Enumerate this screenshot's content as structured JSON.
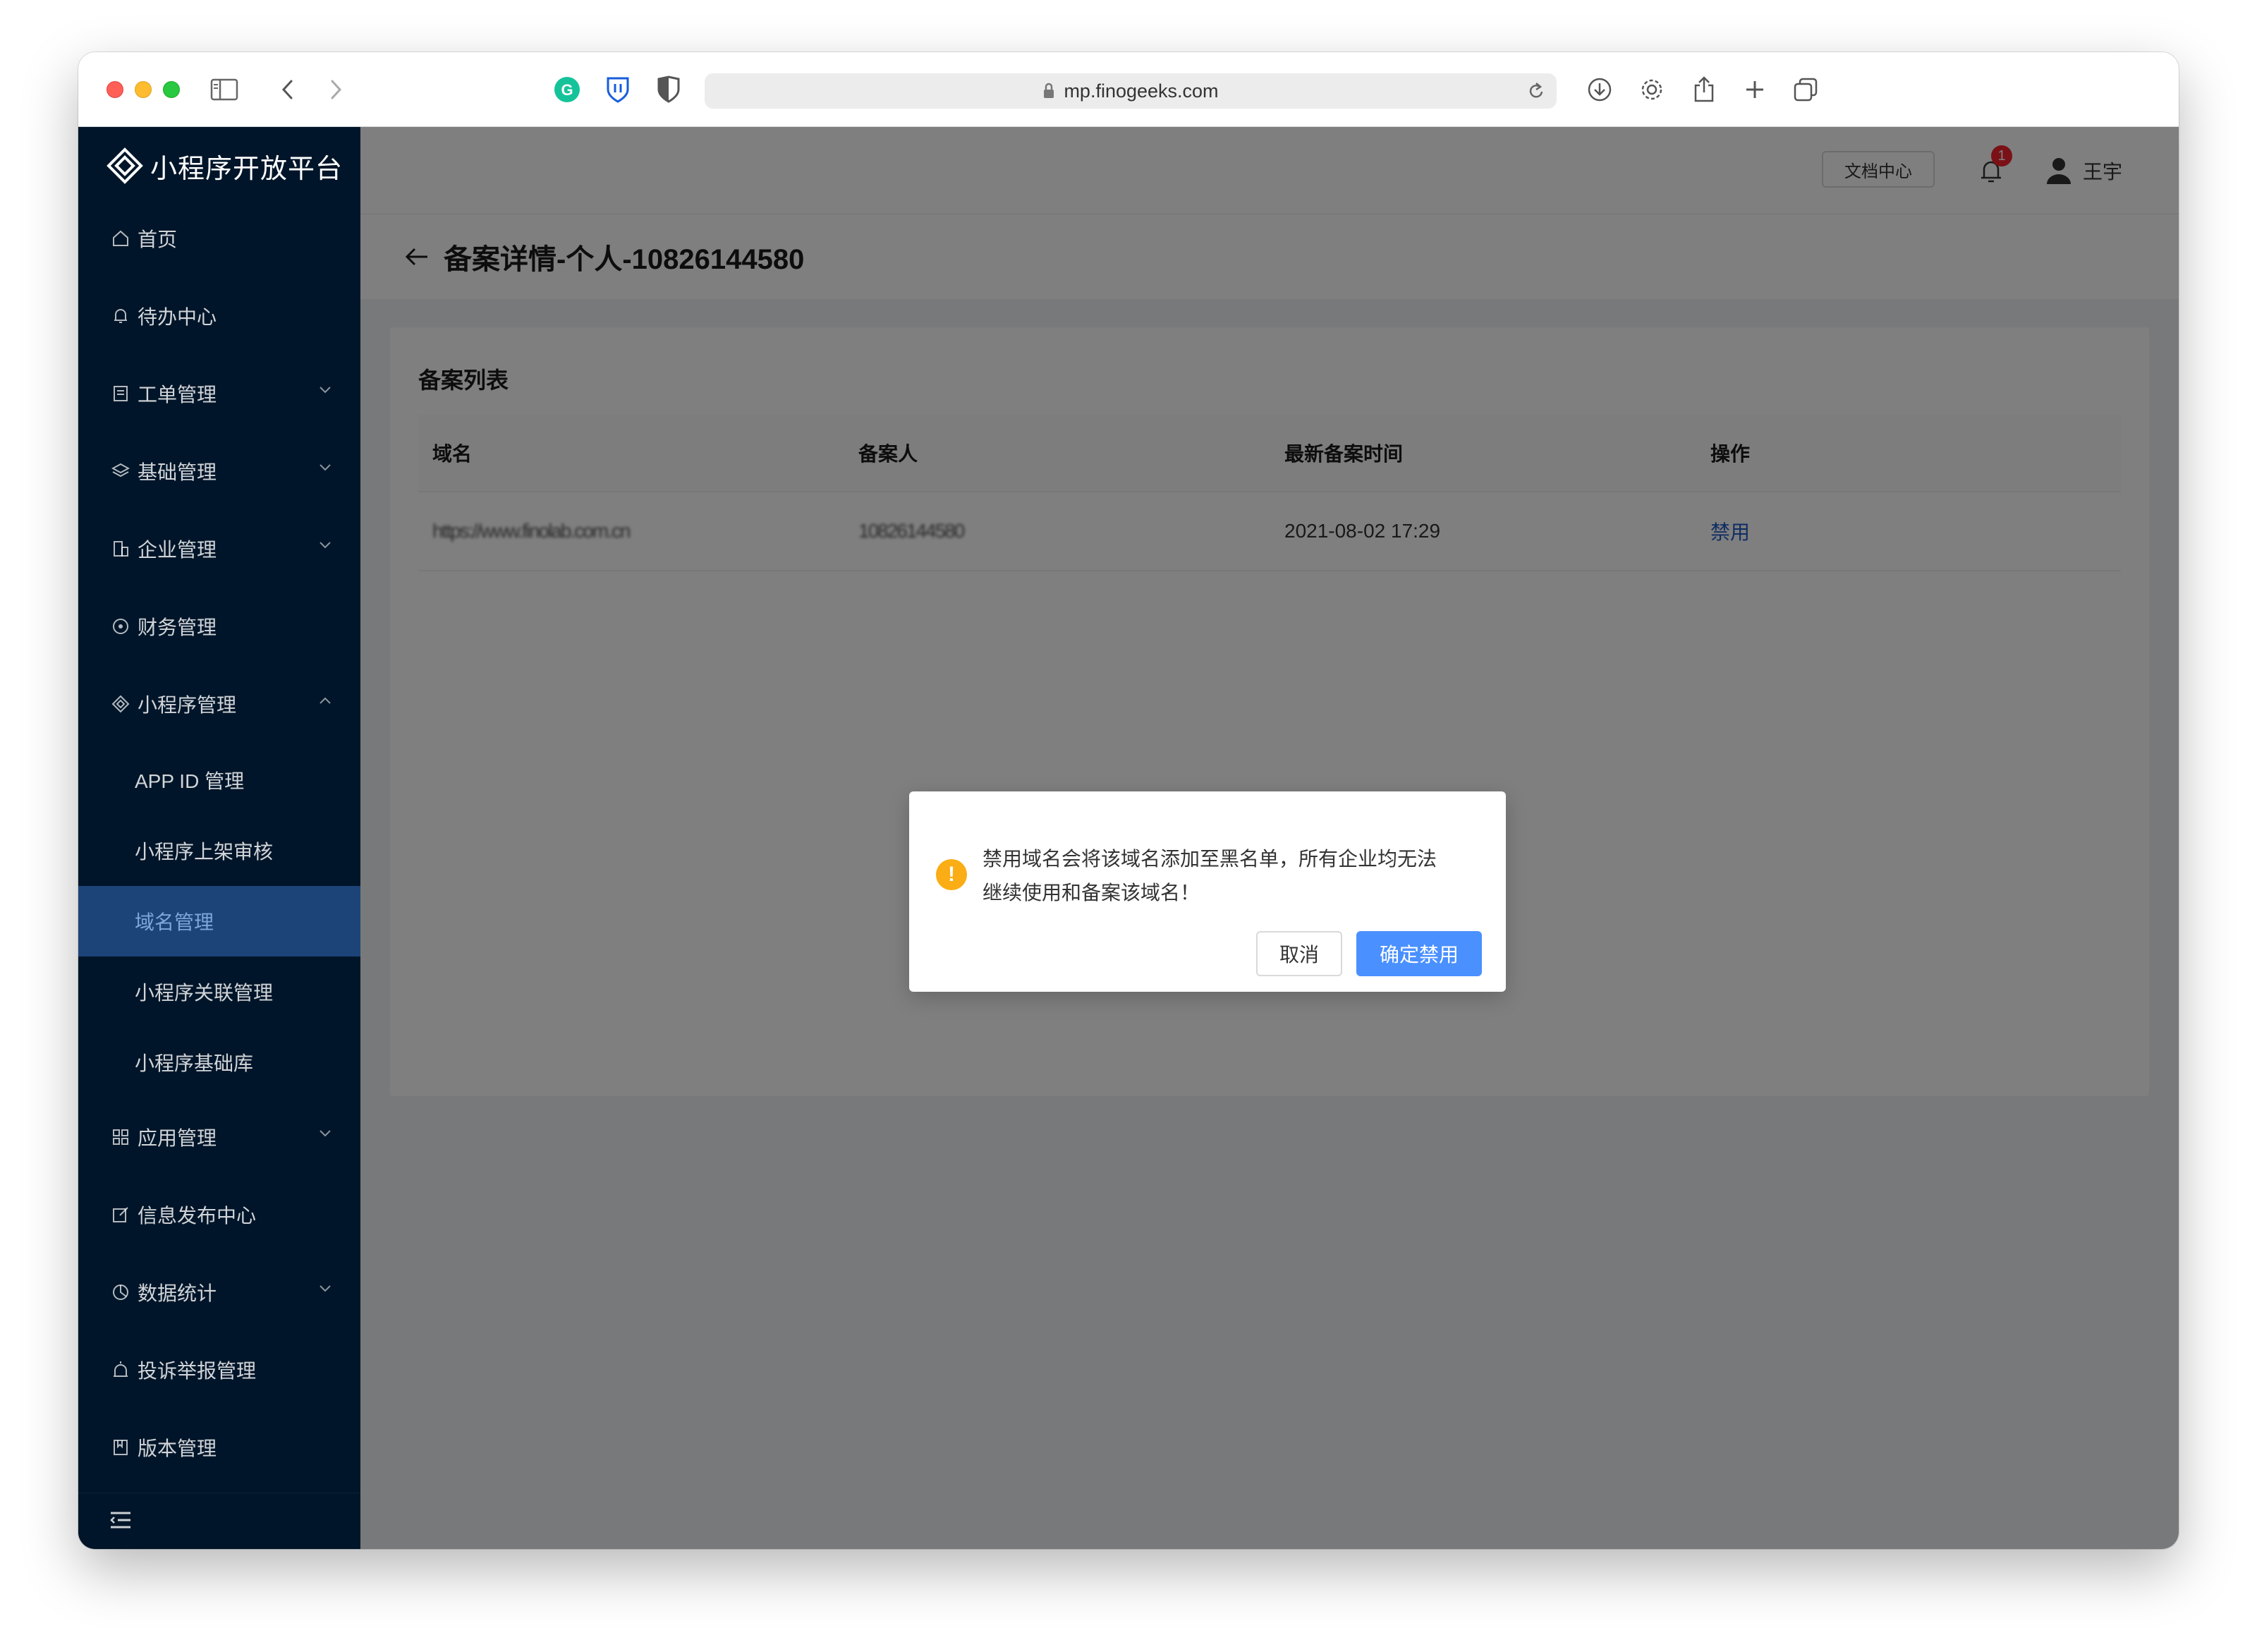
{
  "browser": {
    "url": "mp.finogeeks.com"
  },
  "app": {
    "logo_text": "小程序开放平台"
  },
  "sidebar": {
    "items": [
      {
        "label": "首页",
        "icon": "home-icon"
      },
      {
        "label": "待办中心",
        "icon": "bell-icon"
      },
      {
        "label": "工单管理",
        "icon": "document-icon",
        "expandable": true
      },
      {
        "label": "基础管理",
        "icon": "layers-icon",
        "expandable": true
      },
      {
        "label": "企业管理",
        "icon": "building-icon",
        "expandable": true
      },
      {
        "label": "财务管理",
        "icon": "coin-icon"
      },
      {
        "label": "小程序管理",
        "icon": "diamond-icon",
        "expanded": true
      }
    ],
    "sub_items": [
      {
        "label": "APP ID 管理"
      },
      {
        "label": "小程序上架审核"
      },
      {
        "label": "域名管理",
        "active": true
      },
      {
        "label": "小程序关联管理"
      },
      {
        "label": "小程序基础库"
      }
    ],
    "items_after": [
      {
        "label": "应用管理",
        "icon": "grid-icon",
        "expandable": true
      },
      {
        "label": "信息发布中心",
        "icon": "edit-icon"
      },
      {
        "label": "数据统计",
        "icon": "pie-icon",
        "expandable": true
      },
      {
        "label": "投诉举报管理",
        "icon": "alarm-icon"
      },
      {
        "label": "版本管理",
        "icon": "bookmark-icon"
      }
    ]
  },
  "header": {
    "doc_button": "文档中心",
    "notification_count": "1",
    "user_name": "王宇"
  },
  "page": {
    "title": "备案详情-个人-10826144580"
  },
  "card": {
    "title": "备案列表",
    "columns": [
      "域名",
      "备案人",
      "最新备案时间",
      "操作"
    ],
    "rows": [
      {
        "domain": "https://www.finolab.com.cn",
        "registrant": "10826144580",
        "time": "2021-08-02 17:29",
        "action": "禁用"
      }
    ]
  },
  "dialog": {
    "message_line1": "禁用域名会将该域名添加至黑名单，所有企业均无法",
    "message_line2": "继续使用和备案该域名！",
    "cancel": "取消",
    "confirm": "确定禁用"
  },
  "colors": {
    "sidebar_bg": "#001529",
    "active_item_bg": "#1d4478",
    "primary": "#4a90ff",
    "warning": "#faad14",
    "link": "#1e5bc6"
  }
}
